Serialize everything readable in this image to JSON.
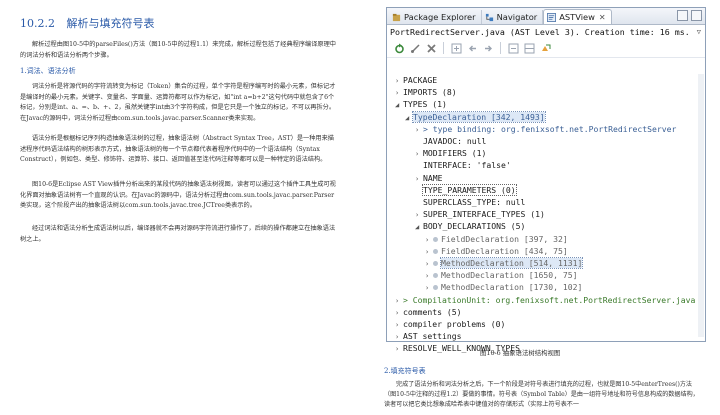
{
  "left_page": {
    "section_number": "10.2.2",
    "section_title": "解析与填充符号表",
    "intro": "解析过程由图10-5中的parseFiles()方法（图10-5中的过程1.1）来完成，解析过程包括了经典程序编译原理中的词法分析和语法分析两个步骤。",
    "sub1": "1.词法、语法分析",
    "p1": "词法分析是将源代码的字符流转变为标记（Token）集合的过程，单个字符是程序编写时的最小元素，但标记才是编译时的最小元素。关键字、变量名、字面量、运算符都可以作为标记，如\"int a=b+2\"这句代码中就包含了6个标记，分别是int、a、=、b、+、2，虽然关键字int由3个字符构成，但是它只是一个独立的标记，不可以再拆分。在Javac的源码中，词法分析过程由com.sun.tools.javac.parser.Scanner类来实现。",
    "p2": "语法分析是根据标记序列构造抽象语法树的过程，抽象语法树（Abstract Syntax Tree，AST）是一种用来描述程序代码语法结构的树形表示方式，抽象语法树的每一个节点都代表着程序代码中的一个语法结构（Syntax Construct），例如包、类型、修饰符、运算符、接口、返回值甚至连代码注释等都可以是一种特定的语法结构。",
    "p3": "图10-6是Eclipse AST View插件分析出来的某段代码的抽象语法树视图，读者可以通过这个插件工具生成可视化界面对抽象语法树有一个直观的认识。在Javac的源码中，语法分析过程由com.sun.tools.javac.parser.Parser类实现，这个阶段产出的抽象语法树以com.sun.tools.javac.tree.JCTree类表示的。",
    "p4": "经过词法和语法分析生成语法树以后，编译器就不会再对源码字符流进行操作了，后续的操作都建立在抽象语法树之上。"
  },
  "eclipse": {
    "tabs": [
      {
        "label": "Package Explorer",
        "active": false
      },
      {
        "label": "Navigator",
        "active": false
      },
      {
        "label": "ASTView",
        "active": true
      }
    ],
    "info_line": "PortRedirectServer.java (AST Level 3).  Creation time: 16 ms.",
    "tree": [
      {
        "indent": 1,
        "arrow": ">",
        "text": "PACKAGE"
      },
      {
        "indent": 1,
        "arrow": ">",
        "text": "IMPORTS (8)"
      },
      {
        "indent": 1,
        "arrow": "v",
        "text": "TYPES (1)"
      },
      {
        "indent": 2,
        "arrow": "v",
        "text": "TypeDeclaration [342, 1493]",
        "style": "blue-sel"
      },
      {
        "indent": 3,
        "arrow": ">",
        "text": "> type binding: org.fenixsoft.net.PortRedirectServer",
        "style": "blue"
      },
      {
        "indent": 3,
        "arrow": "",
        "text": "JAVADOC: null"
      },
      {
        "indent": 3,
        "arrow": ">",
        "text": "MODIFIERS (1)"
      },
      {
        "indent": 3,
        "arrow": "",
        "text": "INTERFACE: 'false'"
      },
      {
        "indent": 3,
        "arrow": ">",
        "text": "NAME"
      },
      {
        "indent": 3,
        "arrow": "",
        "text": "TYPE_PARAMETERS (0)",
        "style": "boxed"
      },
      {
        "indent": 3,
        "arrow": "",
        "text": "SUPERCLASS_TYPE: null"
      },
      {
        "indent": 3,
        "arrow": ">",
        "text": "SUPER_INTERFACE_TYPES (1)"
      },
      {
        "indent": 3,
        "arrow": "v",
        "text": "BODY_DECLARATIONS (5)"
      },
      {
        "indent": 4,
        "arrow": ">",
        "text": "FieldDeclaration [397, 32]",
        "style": "gray"
      },
      {
        "indent": 4,
        "arrow": ">",
        "text": "FieldDeclaration [434, 75]",
        "style": "gray"
      },
      {
        "indent": 4,
        "arrow": ">",
        "text": "MethodDeclaration [514, 1131]",
        "style": "gray-sel"
      },
      {
        "indent": 4,
        "arrow": ">",
        "text": "MethodDeclaration [1650, 75]",
        "style": "gray"
      },
      {
        "indent": 4,
        "arrow": ">",
        "text": "MethodDeclaration [1730, 102]",
        "style": "gray"
      },
      {
        "indent": 1,
        "arrow": ">",
        "text": "> CompilationUnit: org.fenixsoft.net.PortRedirectServer.java",
        "style": "green"
      },
      {
        "indent": 1,
        "arrow": ">",
        "text": "comments (5)"
      },
      {
        "indent": 1,
        "arrow": ">",
        "text": "compiler problems (0)"
      },
      {
        "indent": 1,
        "arrow": ">",
        "text": "AST settings"
      },
      {
        "indent": 1,
        "arrow": ">",
        "text": "RESOLVE_WELL_KNOWN_TYPES"
      }
    ]
  },
  "right_page": {
    "figure_caption": "图10-6   抽象语法树结构视图",
    "sub2": "2.填充符号表",
    "p5": "完成了语法分析和词法分析之后，下一个阶段是对符号表进行填充的过程，也就是图10-5中enterTrees()方法（图10-5中注释的过程1.2）要做的事情。符号表（Symbol Table）是由一组符号地址和符号信息构成的数据结构，读者可以把它类比想象成哈希表中键值对的存储形式（实际上符号表不一"
  }
}
